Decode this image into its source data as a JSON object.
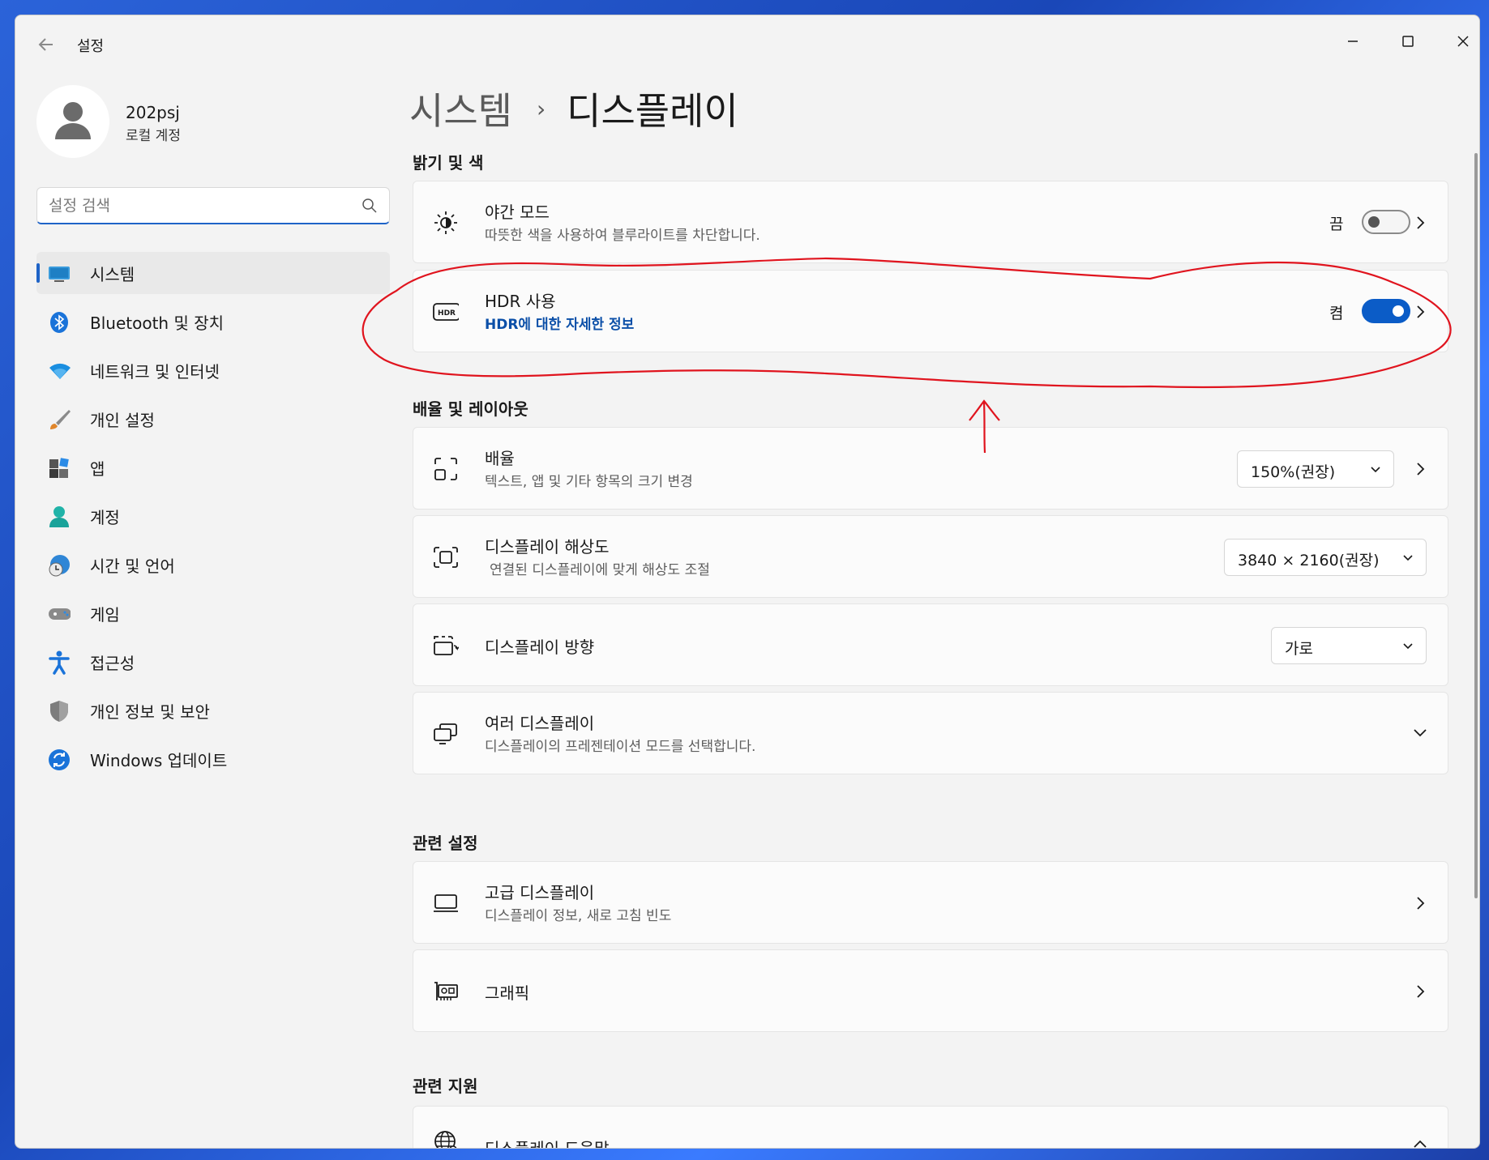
{
  "window": {
    "title": "설정"
  },
  "profile": {
    "name": "202psj",
    "account_type": "로컬 계정"
  },
  "search": {
    "placeholder": "설정 검색"
  },
  "sidebar": {
    "items": [
      {
        "label": "시스템",
        "icon": "system-icon",
        "active": true
      },
      {
        "label": "Bluetooth 및 장치",
        "icon": "bluetooth-icon"
      },
      {
        "label": "네트워크 및 인터넷",
        "icon": "wifi-icon"
      },
      {
        "label": "개인 설정",
        "icon": "brush-icon"
      },
      {
        "label": "앱",
        "icon": "apps-icon"
      },
      {
        "label": "계정",
        "icon": "account-icon"
      },
      {
        "label": "시간 및 언어",
        "icon": "time-language-icon"
      },
      {
        "label": "게임",
        "icon": "gamepad-icon"
      },
      {
        "label": "접근성",
        "icon": "accessibility-icon"
      },
      {
        "label": "개인 정보 및 보안",
        "icon": "shield-icon"
      },
      {
        "label": "Windows 업데이트",
        "icon": "update-icon"
      }
    ]
  },
  "breadcrumb": {
    "parent": "시스템",
    "separator": "›",
    "current": "디스플레이"
  },
  "sections": {
    "brightness": "밝기 및 색",
    "scale_layout": "배율 및 레이아웃",
    "related_settings": "관련 설정",
    "related_support": "관련 지원"
  },
  "night_light": {
    "title": "야간 모드",
    "subtitle": "따뜻한 색을 사용하여 블루라이트를 차단합니다.",
    "state_label": "끔",
    "on": false
  },
  "hdr": {
    "title": "HDR 사용",
    "link": "HDR에 대한 자세한 정보",
    "state_label": "켬",
    "on": true
  },
  "scale": {
    "title": "배율",
    "subtitle": "텍스트, 앱 및 기타 항목의 크기 변경",
    "value": "150%(권장)"
  },
  "resolution": {
    "title": "디스플레이 해상도",
    "subtitle": "연결된 디스플레이에 맞게 해상도 조절",
    "value": "3840 × 2160(권장)"
  },
  "orientation": {
    "title": "디스플레이 방향",
    "value": "가로"
  },
  "multiple_displays": {
    "title": "여러 디스플레이",
    "subtitle": "디스플레이의 프레젠테이션 모드를 선택합니다."
  },
  "advanced_display": {
    "title": "고급 디스플레이",
    "subtitle": "디스플레이 정보, 새로 고침 빈도"
  },
  "graphics": {
    "title": "그래픽"
  },
  "display_help": {
    "title": "디스플레이 도움말"
  },
  "colors": {
    "accent": "#0b5cc7",
    "annotation": "#e0141e",
    "link": "#0b4fa8"
  }
}
